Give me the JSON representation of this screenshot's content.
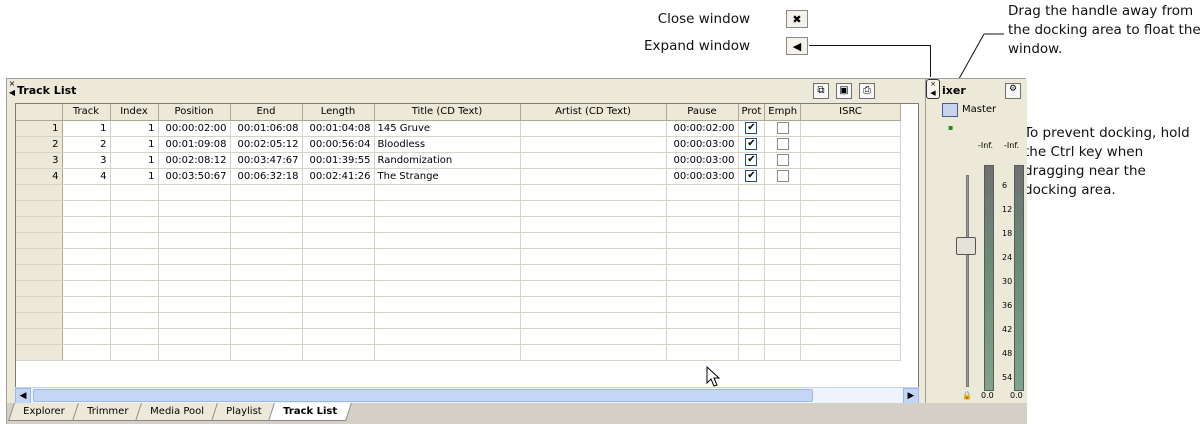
{
  "annotations": {
    "close_window": "Close window",
    "expand_window": "Expand window",
    "drag_handle": "Drag the handle away from the docking area to float the window.",
    "prevent_docking": "To prevent docking, hold the Ctrl key when dragging near the docking area."
  },
  "annotation_buttons": {
    "close": "✖",
    "expand": "◀"
  },
  "window": {
    "title": "Track List",
    "toolbar_icons": [
      "copy-icon",
      "save-icon",
      "print-icon"
    ]
  },
  "table": {
    "columns": [
      "",
      "Track",
      "Index",
      "Position",
      "End",
      "Length",
      "Title (CD Text)",
      "Artist (CD Text)",
      "Pause",
      "Prot",
      "Emph",
      "ISRC"
    ],
    "rows": [
      {
        "n": "1",
        "track": "1",
        "index": "1",
        "position": "00:00:02:00",
        "end": "00:01:06:08",
        "length": "00:01:04:08",
        "title": "145 Gruve",
        "artist": "",
        "pause": "00:00:02:00",
        "prot": true,
        "emph": false,
        "isrc": ""
      },
      {
        "n": "2",
        "track": "2",
        "index": "1",
        "position": "00:01:09:08",
        "end": "00:02:05:12",
        "length": "00:00:56:04",
        "title": "Bloodless",
        "artist": "",
        "pause": "00:00:03:00",
        "prot": true,
        "emph": false,
        "isrc": ""
      },
      {
        "n": "3",
        "track": "3",
        "index": "1",
        "position": "00:02:08:12",
        "end": "00:03:47:67",
        "length": "00:01:39:55",
        "title": "Randomization",
        "artist": "",
        "pause": "00:00:03:00",
        "prot": true,
        "emph": false,
        "isrc": ""
      },
      {
        "n": "4",
        "track": "4",
        "index": "1",
        "position": "00:03:50:67",
        "end": "00:06:32:18",
        "length": "00:02:41:26",
        "title": "The Strange",
        "artist": "",
        "pause": "00:00:03:00",
        "prot": true,
        "emph": false,
        "isrc": ""
      }
    ],
    "empty_rows": 11
  },
  "tabs": [
    {
      "label": "Explorer",
      "active": false
    },
    {
      "label": "Trimmer",
      "active": false
    },
    {
      "label": "Media Pool",
      "active": false
    },
    {
      "label": "Playlist",
      "active": false
    },
    {
      "label": "Track List",
      "active": true
    }
  ],
  "mixer": {
    "title": "Mixer",
    "visible_title": "ixer",
    "master_label": "Master",
    "peak_left": "-Inf.",
    "peak_right": "-Inf.",
    "scale": [
      "6",
      "12",
      "18",
      "24",
      "30",
      "36",
      "42",
      "48",
      "54"
    ],
    "readout_left": "0.0",
    "readout_right": "0.0"
  }
}
